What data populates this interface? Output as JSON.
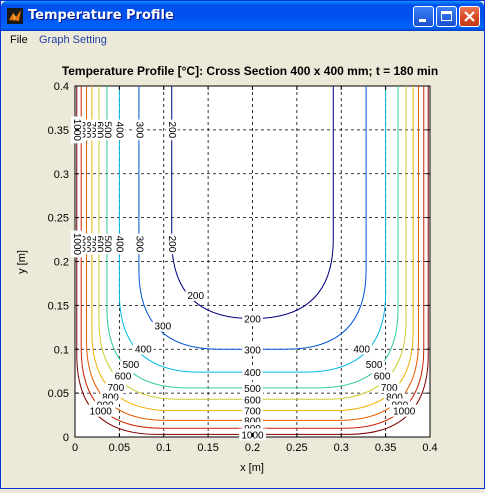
{
  "window": {
    "title": "Temperature Profile",
    "icon": "matlab-icon",
    "controls": [
      "minimize-icon",
      "maximize-icon",
      "close-icon"
    ]
  },
  "menu": {
    "file": "File",
    "graph_setting": "Graph Setting"
  },
  "chart_data": {
    "type": "contour",
    "title": "Temperature Profile [°C]: Cross Section 400 x 400 mm; t = 180 min",
    "xlabel": "x [m]",
    "ylabel": "y [m]",
    "xlim": [
      0,
      0.4
    ],
    "ylim": [
      0,
      0.4
    ],
    "xticks": [
      "0",
      "0.05",
      "0.1",
      "0.15",
      "0.2",
      "0.25",
      "0.3",
      "0.35",
      "0.4"
    ],
    "yticks": [
      "0",
      "0.05",
      "0.1",
      "0.15",
      "0.2",
      "0.25",
      "0.3",
      "0.35",
      "0.4"
    ],
    "grid": true,
    "levels": [
      {
        "value": 200,
        "color": "#000080",
        "xmin": 0.109,
        "bottom": 0.135,
        "labels": [
          "200",
          "200",
          "200",
          "200"
        ]
      },
      {
        "value": 300,
        "color": "#0055D4",
        "xmin": 0.072,
        "bottom": 0.1,
        "labels": [
          "300",
          "300",
          "300",
          "300"
        ]
      },
      {
        "value": 400,
        "color": "#00B8E6",
        "xmin": 0.05,
        "bottom": 0.074,
        "labels": [
          "400",
          "400",
          "400",
          "400",
          "400"
        ]
      },
      {
        "value": 500,
        "color": "#33CC99",
        "xmin": 0.036,
        "bottom": 0.056,
        "labels": [
          "500",
          "500",
          "500",
          "500",
          "500"
        ]
      },
      {
        "value": 600,
        "color": "#CCCC33",
        "xmin": 0.027,
        "bottom": 0.043,
        "labels": [
          "600",
          "600",
          "600",
          "600",
          "600"
        ]
      },
      {
        "value": 700,
        "color": "#F2B200",
        "xmin": 0.019,
        "bottom": 0.03,
        "labels": [
          "700",
          "700",
          "700",
          "700",
          "700"
        ]
      },
      {
        "value": 800,
        "color": "#E65C00",
        "xmin": 0.013,
        "bottom": 0.019,
        "labels": [
          "800",
          "800",
          "800",
          "800",
          "800"
        ]
      },
      {
        "value": 900,
        "color": "#CC2200",
        "xmin": 0.007,
        "bottom": 0.01,
        "labels": [
          "900",
          "900",
          "900",
          "900",
          "900"
        ]
      },
      {
        "value": 1000,
        "color": "#800000",
        "xmin": 0.002,
        "bottom": 0.003,
        "labels": [
          "1000",
          "1000",
          "1000",
          "1000",
          "1000"
        ]
      }
    ]
  }
}
